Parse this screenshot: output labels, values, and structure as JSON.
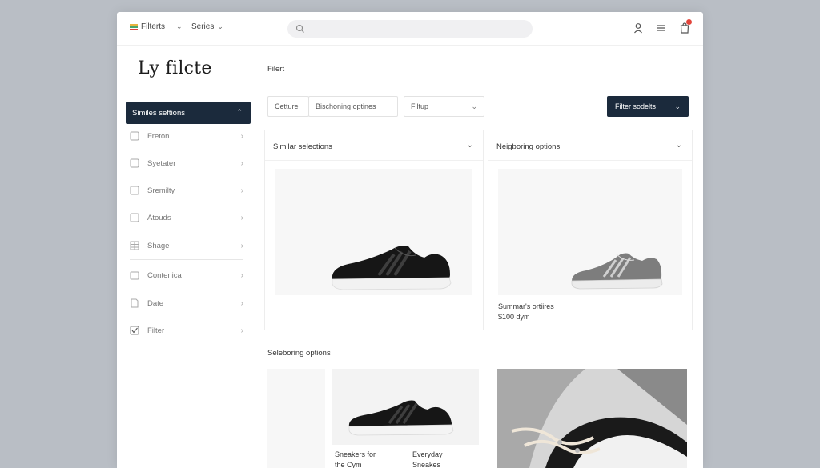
{
  "topbar": {
    "nav": [
      {
        "label": "Filterts",
        "chevron": "chevron-down-icon"
      },
      {
        "label": "Series",
        "chevron": "chevron-down-icon"
      }
    ],
    "search_placeholder": "",
    "icons": [
      "user-icon",
      "menu-icon",
      "cart-icon"
    ],
    "badge_color": "#e2453c"
  },
  "page": {
    "title": "Ly filcte"
  },
  "sidebar": {
    "active": {
      "label": "Similes seftions",
      "icon": "chevron-up-icon"
    },
    "items": [
      {
        "label": "Freton",
        "icon": "checkbox-icon"
      },
      {
        "label": "Syetater",
        "icon": "checkbox-icon"
      },
      {
        "label": "Sremilty",
        "icon": "checkbox-icon"
      },
      {
        "label": "Atouds",
        "icon": "checkbox-icon"
      },
      {
        "label": "Shage",
        "icon": "grid-icon"
      },
      {
        "label": "Contenica",
        "icon": "calendar-icon"
      },
      {
        "label": "Date",
        "icon": "document-icon"
      },
      {
        "label": "Filter",
        "icon": "checked-box-icon"
      }
    ]
  },
  "main": {
    "header_label": "Filert",
    "filters": {
      "field_a": "Cetture",
      "field_b": "Bischoning optines",
      "field_c": "Filtup",
      "apply_label": "Filter sodelts"
    },
    "cards": [
      {
        "title": "Similar selections",
        "image": "black-sneaker",
        "caption_lines": []
      },
      {
        "title": "Neigboring options",
        "image": "grey-sneaker",
        "caption_lines": [
          "Summar's ortiires",
          "$100 dym"
        ]
      }
    ],
    "section2_label": "Seleboring options",
    "tiles": [
      {
        "caption": "Sneakers for the Cym"
      },
      {
        "caption": "Everyday Sneakes"
      }
    ],
    "accent_color": "#1b2a3c"
  }
}
